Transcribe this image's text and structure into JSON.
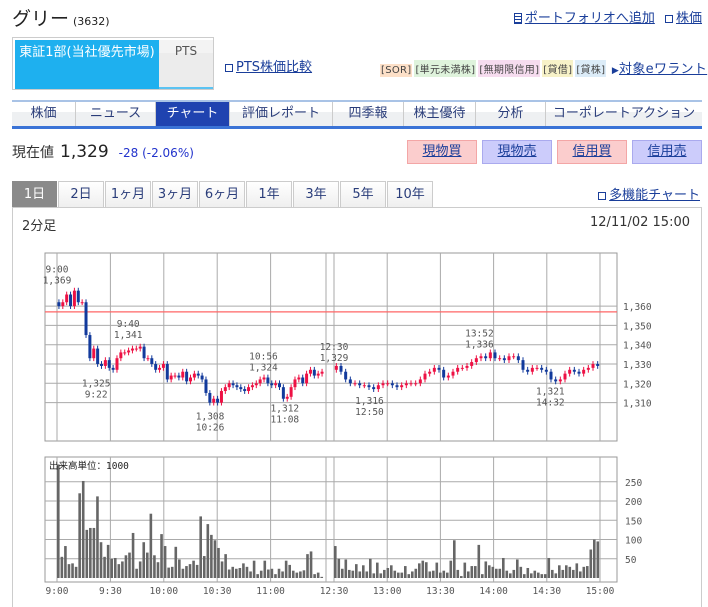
{
  "header": {
    "title": "グリー",
    "code": "(3632)",
    "portfolio_link": "ポートフォリオへ追加",
    "stock_link": "株価"
  },
  "market": {
    "main": "東証1部(当社優先市場)",
    "pts": "PTS",
    "compare_link": "PTS株価比較"
  },
  "badges": [
    {
      "label": "[SOR]",
      "color": "#fde0c8"
    },
    {
      "label": "[単元未満株]",
      "color": "#dff3dc"
    },
    {
      "label": "[無期限信用]",
      "color": "#f6dcef"
    },
    {
      "label": "[貸借]",
      "color": "#f7f2c8"
    },
    {
      "label": "[貸株]",
      "color": "#dcecf8"
    }
  ],
  "ewarrant_link": "対象eワラント",
  "nav": [
    "株価",
    "ニュース",
    "チャート",
    "評価レポート",
    "四季報",
    "株主優待",
    "分析",
    "コーポレートアクション"
  ],
  "nav_selected": 2,
  "price": {
    "label": "現在値",
    "value": "1,329",
    "change": "-28 (-2.06%)"
  },
  "trade_buttons": [
    "現物買",
    "現物売",
    "信用買",
    "信用売"
  ],
  "periods": [
    "1日",
    "2日",
    "1ヶ月",
    "3ヶ月",
    "6ヶ月",
    "1年",
    "3年",
    "5年",
    "10年"
  ],
  "period_selected": 0,
  "multi_chart_link": "多機能チャート",
  "chart": {
    "interval": "2分足",
    "timestamp": "12/11/02 15:00",
    "volume_unit": "出来高単位：1000"
  },
  "colors": {
    "up": "#ee1144",
    "down": "#123a9c",
    "prev_close_line": "#ff6666"
  },
  "chart_data": {
    "type": "candlestick",
    "prev_close": 1357,
    "y_ticks": [
      "1,360",
      "1,350",
      "1,340",
      "1,330",
      "1,320",
      "1,310"
    ],
    "y_tick_values": [
      1360,
      1350,
      1340,
      1330,
      1320,
      1310
    ],
    "x_ticks": [
      "9:00",
      "9:30",
      "10:00",
      "10:30",
      "11:00",
      "12:30",
      "13:00",
      "13:30",
      "14:00",
      "14:30",
      "15:00"
    ],
    "vol_ticks": [
      "250",
      "200",
      "150",
      "100",
      "50"
    ],
    "vol_tick_values": [
      250,
      200,
      150,
      100,
      50
    ],
    "annotations": [
      {
        "time": "9:00",
        "price": "1,369",
        "t": 0,
        "p": 1369,
        "pos": "above"
      },
      {
        "time": "9:22",
        "price": "1,325",
        "t": 22,
        "p": 1325,
        "pos": "below"
      },
      {
        "time": "9:40",
        "price": "1,341",
        "t": 40,
        "p": 1341,
        "pos": "above"
      },
      {
        "time": "10:26",
        "price": "1,308",
        "t": 86,
        "p": 1308,
        "pos": "below"
      },
      {
        "time": "10:56",
        "price": "1,324",
        "t": 116,
        "p": 1324,
        "pos": "above"
      },
      {
        "time": "11:08",
        "price": "1,312",
        "t": 128,
        "p": 1312,
        "pos": "below"
      },
      {
        "time": "12:30",
        "price": "1,329",
        "t": 150,
        "p": 1329,
        "pos": "above"
      },
      {
        "time": "12:50",
        "price": "1,316",
        "t": 170,
        "p": 1316,
        "pos": "below"
      },
      {
        "time": "13:52",
        "price": "1,336",
        "t": 232,
        "p": 1336,
        "pos": "above"
      },
      {
        "time": "14:32",
        "price": "1,321",
        "t": 272,
        "p": 1321,
        "pos": "below"
      }
    ],
    "morning_open": 1362,
    "morning_closes": [
      1360,
      1362,
      1366,
      1360,
      1368,
      1362,
      1362,
      1345,
      1333,
      1338,
      1330,
      1329,
      1332,
      1328,
      1327,
      1333,
      1336,
      1336,
      1337,
      1338,
      1338,
      1339,
      1333,
      1333,
      1330,
      1327,
      1328,
      1330,
      1322,
      1324,
      1324,
      1323,
      1326,
      1321,
      1323,
      1325,
      1324,
      1322,
      1315,
      1310,
      1312,
      1310,
      1316,
      1318,
      1320,
      1319,
      1318,
      1317,
      1316,
      1318,
      1319,
      1320,
      1322,
      1323,
      1320,
      1319,
      1320,
      1318,
      1312,
      1313,
      1318,
      1322,
      1323,
      1320,
      1325,
      1327,
      1324,
      1325,
      1326
    ],
    "afternoon_open": 1327,
    "afternoon_closes": [
      1329,
      1326,
      1322,
      1320,
      1320,
      1319,
      1319,
      1318,
      1317,
      1319,
      1320,
      1320,
      1319,
      1318,
      1319,
      1320,
      1320,
      1320,
      1322,
      1325,
      1326,
      1328,
      1327,
      1323,
      1324,
      1326,
      1328,
      1328,
      1329,
      1331,
      1333,
      1334,
      1333,
      1336,
      1333,
      1333,
      1332,
      1334,
      1334,
      1332,
      1327,
      1326,
      1328,
      1328,
      1327,
      1326,
      1322,
      1321,
      1322,
      1325,
      1327,
      1326,
      1325,
      1327,
      1328,
      1330,
      1329
    ],
    "morning_volume": [
      295,
      55,
      83,
      36,
      38,
      29,
      220,
      252,
      125,
      130,
      130,
      212,
      93,
      55,
      86,
      50,
      52,
      36,
      43,
      59,
      66,
      117,
      24,
      43,
      93,
      66,
      167,
      59,
      41,
      114,
      83,
      27,
      29,
      81,
      48,
      24,
      31,
      36,
      45,
      34,
      160,
      57,
      140,
      112,
      98,
      78,
      43,
      62,
      22,
      29,
      24,
      26,
      38,
      29,
      17,
      45,
      10,
      19,
      45,
      22,
      24,
      10,
      24,
      17,
      45,
      34,
      19,
      14,
      17,
      20,
      62,
      69,
      10,
      14,
      3
    ],
    "afternoon_volume": [
      83,
      50,
      24,
      48,
      21,
      19,
      36,
      17,
      33,
      17,
      50,
      12,
      40,
      12,
      21,
      26,
      33,
      19,
      14,
      14,
      31,
      10,
      17,
      24,
      38,
      45,
      41,
      17,
      19,
      40,
      14,
      19,
      14,
      45,
      98,
      21,
      5,
      40,
      17,
      31,
      31,
      86,
      10,
      43,
      33,
      29,
      24,
      24,
      52,
      19,
      12,
      21,
      48,
      29,
      10,
      26,
      12,
      19,
      14,
      10,
      10,
      52,
      21,
      12,
      33,
      21,
      33,
      29,
      21,
      38,
      17,
      29,
      31,
      74,
      100,
      95
    ]
  }
}
